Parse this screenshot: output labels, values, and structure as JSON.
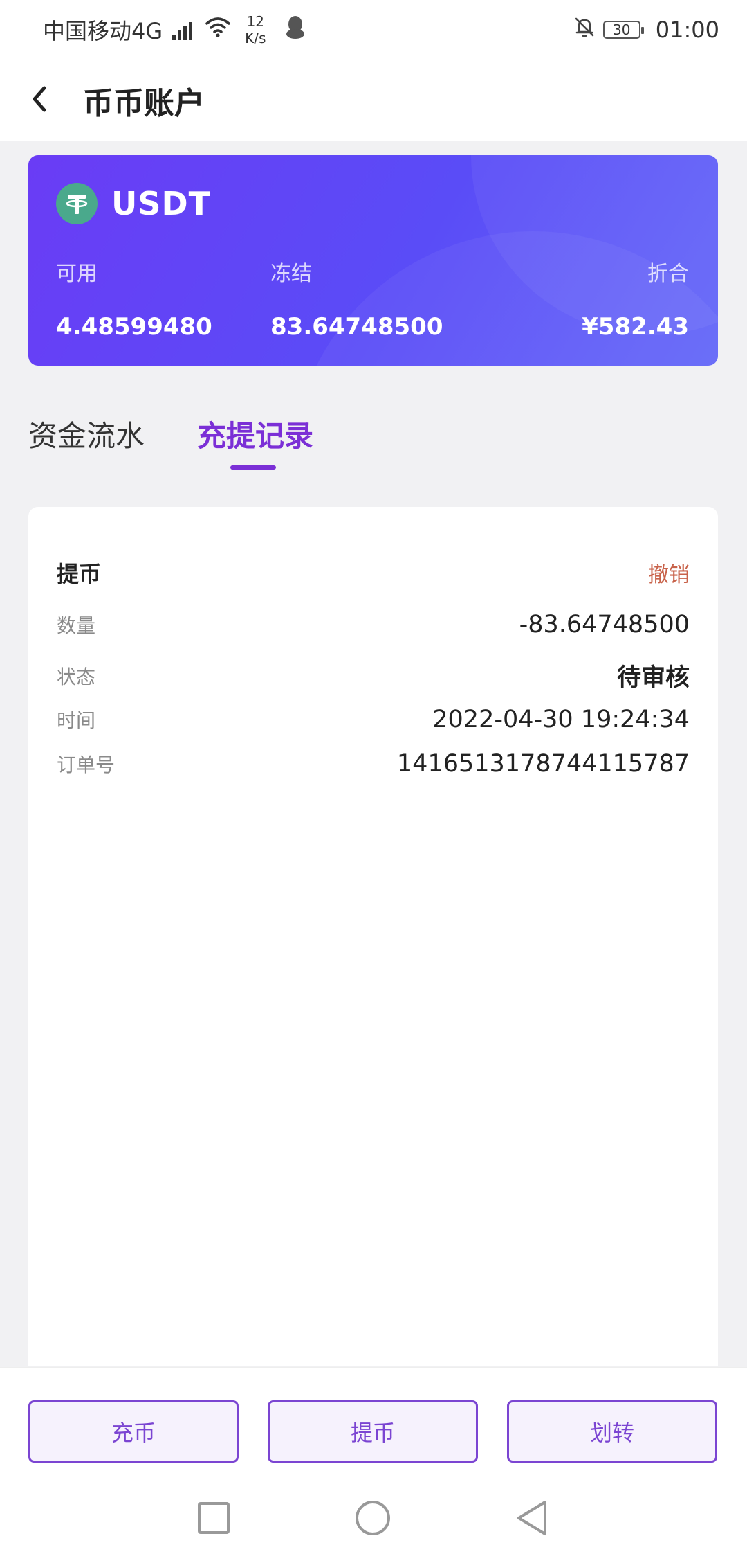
{
  "status_bar": {
    "carrier": "中国移动4G",
    "net_badge": "4G",
    "speed_value": "12",
    "speed_unit": "K/s",
    "battery": "30",
    "time": "01:00"
  },
  "header": {
    "title": "币币账户"
  },
  "asset": {
    "coin": "USDT",
    "available_label": "可用",
    "available_value": "4.48599480",
    "frozen_label": "冻结",
    "frozen_value": "83.64748500",
    "equivalent_label": "折合",
    "equivalent_value": "¥582.43"
  },
  "tabs": [
    {
      "label": "资金流水",
      "active": false
    },
    {
      "label": "充提记录",
      "active": true
    }
  ],
  "records": [
    {
      "type": "提币",
      "action": "撤销",
      "amount_label": "数量",
      "amount": "-83.64748500",
      "status_label": "状态",
      "status": "待审核",
      "time_label": "时间",
      "time": "2022-04-30 19:24:34",
      "order_label": "订单号",
      "order_no": "1416513178744115787"
    }
  ],
  "actions": {
    "deposit": "充币",
    "withdraw": "提币",
    "transfer": "划转"
  },
  "colors": {
    "accent": "#7b2fd6",
    "card_gradient_start": "#6a3cf5",
    "card_gradient_end": "#6468f8",
    "cancel": "#c8624a",
    "usdt": "#4aa98c"
  },
  "icons": [
    "back-arrow-icon",
    "usdt-logo-icon",
    "wifi-icon",
    "qq-icon",
    "bell-off-icon",
    "battery-icon",
    "square-nav-icon",
    "circle-nav-icon",
    "triangle-back-nav-icon"
  ]
}
